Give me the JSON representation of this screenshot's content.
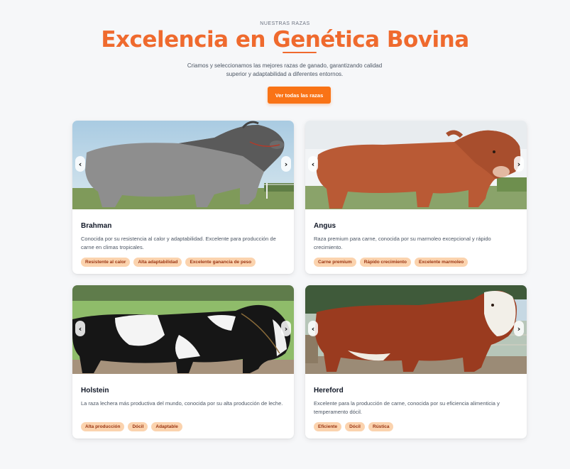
{
  "header": {
    "eyebrow": "NUESTRAS RAZAS",
    "title": "Excelencia en Genética Bovina",
    "subtitle": "Criamos y seleccionamos las mejores razas de ganado, garantizando calidad superior y adaptabilidad a diferentes entornos.",
    "cta_label": "Ver todas las razas"
  },
  "colors": {
    "accent": "#f97316",
    "title": "#ef6a2e",
    "tag_bg": "#fbd3ae",
    "tag_text": "#9a3412"
  },
  "nav_icons": {
    "prev": "‹",
    "next": "›"
  },
  "breeds": [
    {
      "name": "Brahman",
      "description": "Conocida por su resistencia al calor y adaptabilidad. Excelente para producción de carne en climas tropicales.",
      "tags": [
        "Resistente al calor",
        "Alta adaptabilidad",
        "Excelente ganancia de peso"
      ]
    },
    {
      "name": "Angus",
      "description": "Raza premium para carne, conocida por su marmoleo excepcional y rápido crecimiento.",
      "tags": [
        "Carne premium",
        "Rápido crecimiento",
        "Excelente marmoleo"
      ]
    },
    {
      "name": "Holstein",
      "description": "La raza lechera más productiva del mundo, conocida por su alta producción de leche.",
      "tags": [
        "Alta producción",
        "Dócil",
        "Adaptable"
      ]
    },
    {
      "name": "Hereford",
      "description": "Excelente para la producción de carne, conocida por su eficiencia alimenticia y temperamento dócil.",
      "tags": [
        "Eficiente",
        "Dócil",
        "Rústica"
      ]
    }
  ]
}
